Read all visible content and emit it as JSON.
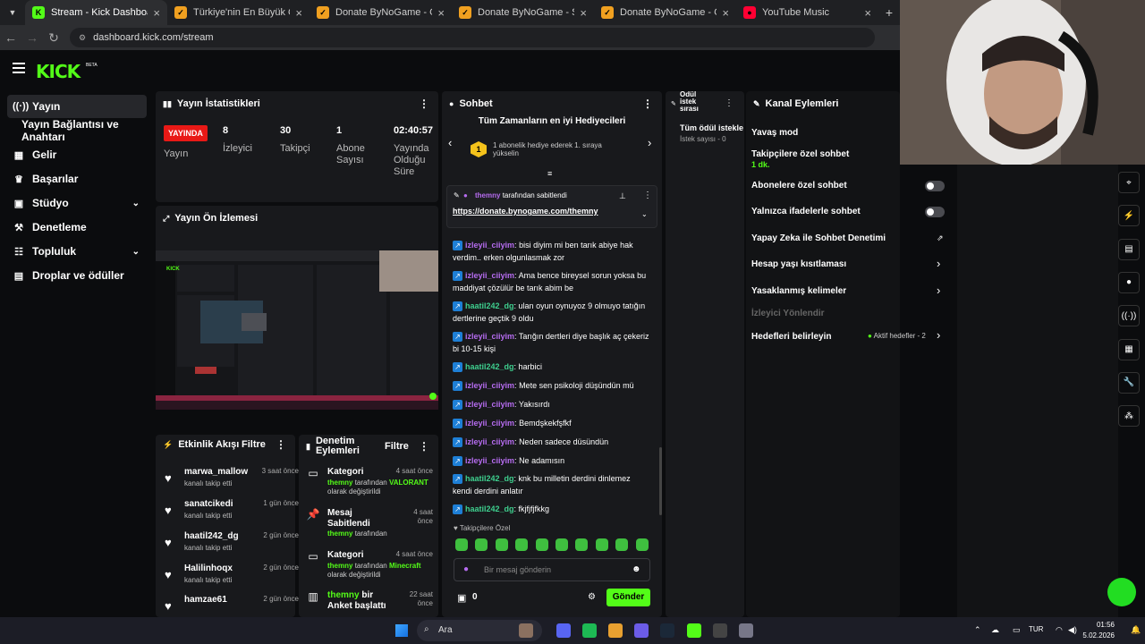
{
  "browser": {
    "tabs": [
      {
        "title": "Stream - Kick Dashboard",
        "color": "#53fc18",
        "glyph": "K",
        "active": true
      },
      {
        "title": "Türkiye'nin En Büyük Oyuncu D",
        "color": "#f0a020",
        "glyph": "✓",
        "active": false
      },
      {
        "title": "Donate ByNoGame - Gelen/Gid",
        "color": "#f0a020",
        "glyph": "✓",
        "active": false
      },
      {
        "title": "Donate ByNoGame - Streamer",
        "color": "#f0a020",
        "glyph": "✓",
        "active": false
      },
      {
        "title": "Donate ByNoGame - Gelen/Gid",
        "color": "#f0a020",
        "glyph": "✓",
        "active": false
      },
      {
        "title": "YouTube Music",
        "color": "#ff0033",
        "glyph": "●",
        "active": false
      }
    ],
    "url": "dashboard.kick.com/stream"
  },
  "header": {
    "logo": "KICK",
    "beta": "BETA"
  },
  "sidebar": {
    "items": [
      {
        "label": "Yayın",
        "icon": "broadcast-icon",
        "glyph": "((·))"
      },
      {
        "label": "Yayın Bağlantısı ve Anahtarı",
        "icon": "",
        "glyph": ""
      },
      {
        "label": "Gelir",
        "icon": "revenue-icon",
        "glyph": "▦"
      },
      {
        "label": "Başarılar",
        "icon": "trophy-icon",
        "glyph": "🏆"
      },
      {
        "label": "Stüdyo",
        "icon": "studio-icon",
        "glyph": "▣"
      },
      {
        "label": "Denetleme",
        "icon": "moderation-icon",
        "glyph": "⚒"
      },
      {
        "label": "Topluluk",
        "icon": "community-icon",
        "glyph": "👥"
      },
      {
        "label": "Droplar ve ödüller",
        "icon": "drops-icon",
        "glyph": "▤"
      }
    ]
  },
  "stats": {
    "title": "Yayın İstatistikleri",
    "live": "YAYINDA",
    "live_label": "Yayın",
    "viewers": "8",
    "viewers_label": "İzleyici",
    "followers": "30",
    "followers_label": "Takipçi",
    "subs": "1",
    "subs_label": "Abone Sayısı",
    "duration": "02:40:57",
    "duration_label": "Yayında Olduğu Süre"
  },
  "preview": {
    "title": "Yayın Ön İzlemesi"
  },
  "activity": {
    "title": "Etkinlik Akışı",
    "filter": "Filtre",
    "items": [
      {
        "name": "marwa_mallow",
        "action": "kanalı takip etti",
        "time": "3 saat önce"
      },
      {
        "name": "sanatcikedi",
        "action": "kanalı takip etti",
        "time": "1 gün önce"
      },
      {
        "name": "haatil242_dg",
        "action": "kanalı takip etti",
        "time": "2 gün önce"
      },
      {
        "name": "Halilinhoqx",
        "action": "kanalı takip etti",
        "time": "2 gün önce"
      },
      {
        "name": "hamzae61",
        "action": "",
        "time": "2 gün önce"
      }
    ]
  },
  "modactions": {
    "title": "Denetim Eylemleri",
    "filter": "Filtre",
    "items": [
      {
        "title": "Kategori",
        "user": "themny",
        "by": "tarafından",
        "value": "VALORANT",
        "suffix": "olarak değiştirildi",
        "time": "4 saat önce",
        "icon": "category-icon",
        "glyph": "▭"
      },
      {
        "title": "Mesaj Sabitlendi",
        "user": "themny",
        "by": "tarafından",
        "value": "",
        "suffix": "",
        "time": "4 saat önce",
        "icon": "pin-icon",
        "glyph": "📌"
      },
      {
        "title": "Kategori",
        "user": "themny",
        "by": "tarafından",
        "value": "Minecraft",
        "suffix": "olarak değiştirildi",
        "time": "4 saat önce",
        "icon": "category-icon",
        "glyph": "▭"
      },
      {
        "title": "themny",
        "title2": "bir Anket başlattı",
        "time": "22 saat önce",
        "icon": "poll-icon",
        "glyph": "▥"
      }
    ]
  },
  "chat": {
    "title": "Sohbet",
    "gifters_title": "Tüm Zamanların en iyi Hediyecileri",
    "gifter_rank": "1",
    "gifter_text": "1 abonelik hediye ederek 1. sıraya yükselin",
    "pinned_by": "themny",
    "pinned_by_suffix": "tarafından sabitlendi",
    "pinned_link": "https://donate.bynogame.com/themny",
    "messages": [
      {
        "user": "izleyii_ciiyim",
        "cls": "u-p",
        "text": "bisi diyim mi ben tarık abiye hak verdim.. erken olgunlasmak zor"
      },
      {
        "user": "izleyii_ciiyim",
        "cls": "u-p",
        "text": "Ama bence bireysel sorun yoksa bu maddiyat çözülür be tarık abim be"
      },
      {
        "user": "haatil242_dg",
        "cls": "u-g",
        "text": "ulan oyun oynuyoz 9 olmuyo tatığın dertlerine geçtik 9 oldu"
      },
      {
        "user": "izleyii_ciiyim",
        "cls": "u-p",
        "text": "Tarığın dertleri diye başlık aç çekeriz bi 10-15 kişi"
      },
      {
        "user": "haatil242_dg",
        "cls": "u-g",
        "text": "harbici"
      },
      {
        "user": "izleyii_ciiyim",
        "cls": "u-p",
        "text": "Mete sen psikoloji düşündün mü"
      },
      {
        "user": "izleyii_ciiyim",
        "cls": "u-p",
        "text": "Yakısırdı"
      },
      {
        "user": "izleyii_ciiyim",
        "cls": "u-p",
        "text": "Bemdşkekfşfkf"
      },
      {
        "user": "izleyii_ciiyim",
        "cls": "u-p",
        "text": "Neden sadece düsündün"
      },
      {
        "user": "izleyii_ciiyim",
        "cls": "u-p",
        "text": "Ne adamısın"
      },
      {
        "user": "haatil242_dg",
        "cls": "u-g",
        "text": "knk bu milletin derdini dinlemez kendi derdini anlatır"
      },
      {
        "user": "haatil242_dg",
        "cls": "u-g",
        "text": "fkjfjfjfkkg"
      }
    ],
    "followers_only": "Takipçilere Özel",
    "input_placeholder": "Bir mesaj gönderin",
    "points": "0",
    "send": "Gönder"
  },
  "rewards": {
    "title": "Ödül istek sırası",
    "all": "Tüm ödül istekle",
    "count": "İstek sayısı - 0"
  },
  "channel": {
    "title": "Kanal Eylemleri",
    "slow": "Yavaş mod",
    "followers_chat": "Takipçilere özel sohbet",
    "followers_chat_value": "1 dk.",
    "subs_chat": "Abonelere özel sohbet",
    "emote_chat": "Yalnızca ifadelerle sohbet",
    "ai_mod": "Yapay Zeka ile Sohbet Denetimi",
    "age": "Hesap yaşı kısıtlaması",
    "banned": "Yasaklanmış kelimeler",
    "redirect": "İzleyici Yönlendir",
    "goals": "Hedefleri belirleyin",
    "goals_status": "Aktif hedefler - 2"
  },
  "taskbar": {
    "search": "Ara",
    "lang": "TUR",
    "time": "01:56",
    "date": "5.02.2026"
  }
}
